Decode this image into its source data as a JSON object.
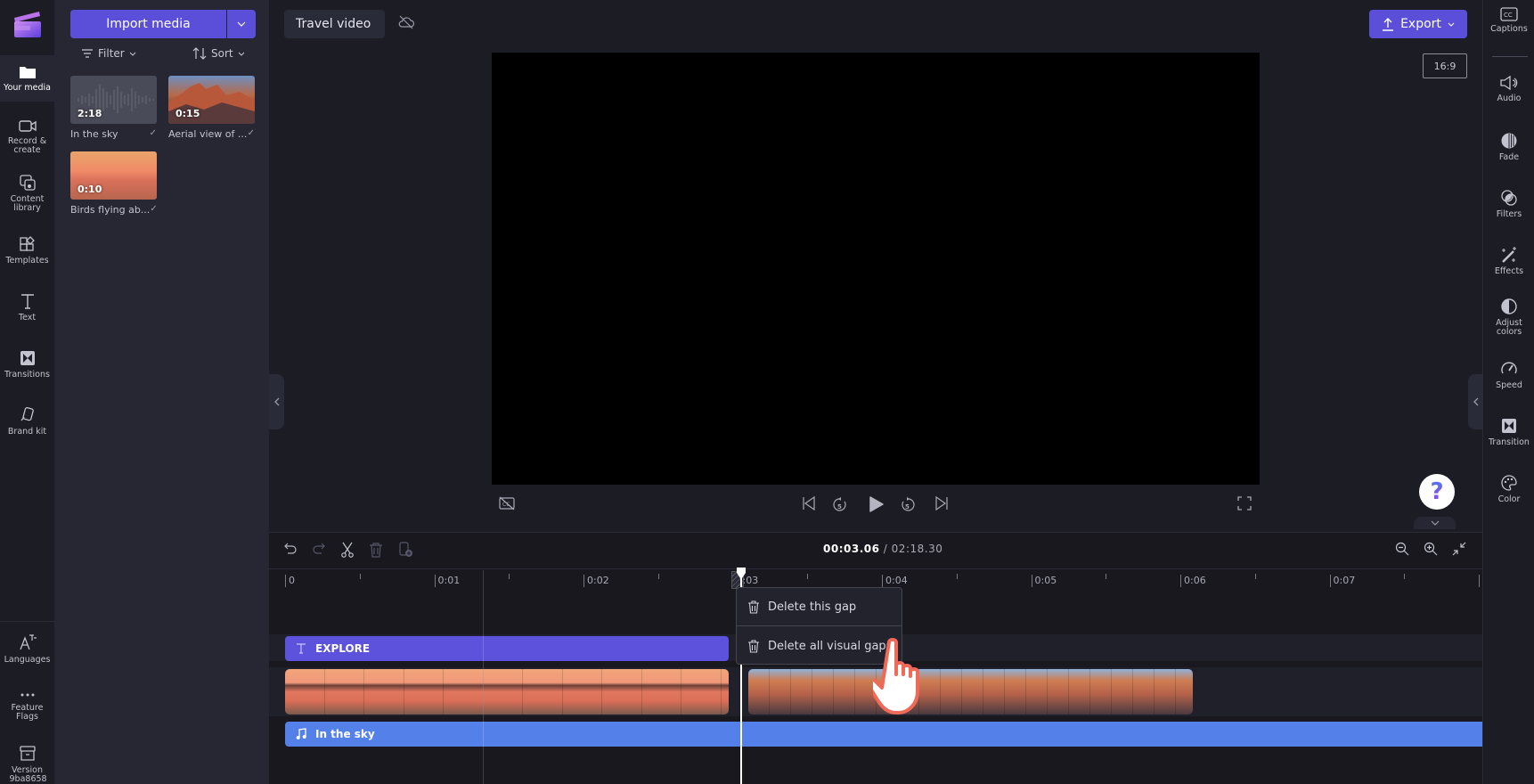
{
  "nav": {
    "items": [
      {
        "label": "Your media",
        "icon": "folder-icon",
        "active": true
      },
      {
        "label": "Record & create",
        "icon": "camera-icon"
      },
      {
        "label": "Content library",
        "icon": "content-library-icon"
      },
      {
        "label": "Templates",
        "icon": "templates-icon"
      },
      {
        "label": "Text",
        "icon": "text-icon"
      },
      {
        "label": "Transitions",
        "icon": "transitions-icon"
      },
      {
        "label": "Brand kit",
        "icon": "brand-kit-icon"
      }
    ],
    "bottom": [
      {
        "label": "Languages",
        "icon": "languages-icon"
      },
      {
        "label": "Feature Flags",
        "icon": "more-icon"
      },
      {
        "label": "Version 9ba8658",
        "icon": "archive-icon"
      }
    ]
  },
  "media": {
    "import_label": "Import media",
    "filter_label": "Filter",
    "sort_label": "Sort",
    "items": [
      {
        "name": "In the sky",
        "duration": "2:18",
        "type": "audio"
      },
      {
        "name": "Aerial view of ...",
        "duration": "0:15",
        "type": "video"
      },
      {
        "name": "Birds flying ab...",
        "duration": "0:10",
        "type": "video"
      }
    ]
  },
  "header": {
    "project_title": "Travel video",
    "export_label": "Export",
    "aspect_ratio": "16:9"
  },
  "props": {
    "items": [
      {
        "label": "Captions",
        "icon": "captions-icon"
      },
      {
        "label": "Audio",
        "icon": "audio-icon"
      },
      {
        "label": "Fade",
        "icon": "fade-icon"
      },
      {
        "label": "Filters",
        "icon": "filters-icon"
      },
      {
        "label": "Effects",
        "icon": "effects-icon"
      },
      {
        "label": "Adjust colors",
        "icon": "adjust-colors-icon"
      },
      {
        "label": "Speed",
        "icon": "speed-icon"
      },
      {
        "label": "Transition",
        "icon": "transition-icon"
      },
      {
        "label": "Color",
        "icon": "color-palette-icon"
      }
    ]
  },
  "help": {
    "symbol": "?"
  },
  "timeline": {
    "current_time": "00:03.06",
    "separator": "/",
    "total_time": "02:18.30",
    "ruler_labels": [
      "0",
      "0:01",
      "0:02",
      "0:03",
      "0:04",
      "0:05",
      "0:06",
      "0:07"
    ],
    "text_clip": "EXPLORE",
    "audio_clip": "In the sky"
  },
  "context_menu": {
    "items": [
      {
        "label": "Delete this gap",
        "icon": "trash-icon"
      },
      {
        "label": "Delete all visual gaps",
        "icon": "trash-icon"
      }
    ]
  },
  "colors": {
    "accent": "#5b4fd9",
    "text_clip": "#5d52db",
    "audio_clip": "#5480ea"
  }
}
